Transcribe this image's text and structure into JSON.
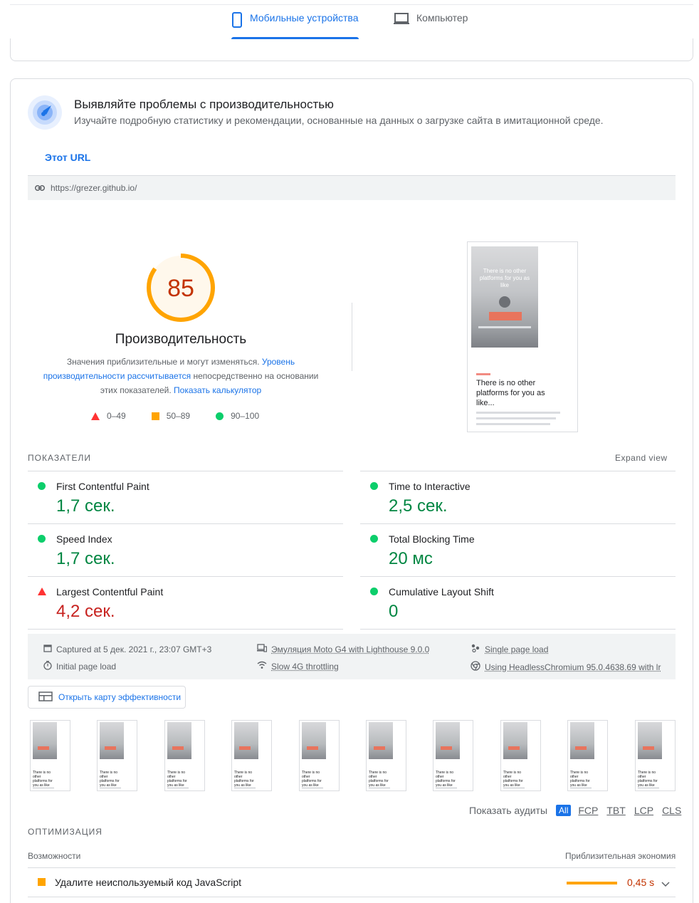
{
  "device_tabs": {
    "mobile": "Мобильные устройства",
    "desktop": "Компьютер"
  },
  "hero": {
    "title": "Выявляйте проблемы с производительностью",
    "subtitle": "Изучайте подробную статистику и рекомендации, основанные на данных о загрузке сайта в имитационной среде."
  },
  "url_tab": "Этот URL",
  "url": "https://grezer.github.io/",
  "score": {
    "value": "85",
    "fraction": 0.85,
    "title": "Производительность",
    "desc_1": "Значения приблизительные и могут изменяться. ",
    "desc_link_1": "Уровень производительности рассчитывается",
    "desc_2": " непосредственно на основании этих показателей. ",
    "desc_link_2": "Показать калькулятор",
    "legend": [
      "0–49",
      "50–89",
      "90–100"
    ]
  },
  "screenshot": {
    "hero_text": "There is no other platforms for you as like",
    "heading": "There is no other platforms for you as like..."
  },
  "metrics": {
    "section_title": "ПОКАЗАТЕЛИ",
    "expand": "Expand view",
    "left": [
      {
        "title": "First Contentful Paint",
        "value": "1,7 сек.",
        "status": "pass"
      },
      {
        "title": "Speed Index",
        "value": "1,7 сек.",
        "status": "pass"
      },
      {
        "title": "Largest Contentful Paint",
        "value": "4,2 сек.",
        "status": "fail"
      }
    ],
    "right": [
      {
        "title": "Time to Interactive",
        "value": "2,5 сек.",
        "status": "pass"
      },
      {
        "title": "Total Blocking Time",
        "value": "20 мс",
        "status": "pass"
      },
      {
        "title": "Cumulative Layout Shift",
        "value": "0",
        "status": "pass"
      }
    ]
  },
  "meta": {
    "captured": "Captured at 5 дек. 2021 г., 23:07 GMT+3",
    "initial": "Initial page load",
    "emulation": "Эмуляция Moto G4 with Lighthouse 9.0.0",
    "throttling": "Slow 4G throttling",
    "single": "Single page load",
    "browser": "Using HeadlessChromium 95.0.4638.69 with lr"
  },
  "treemap_button": "Открыть карту эффективности",
  "filmstrip": {
    "frame_text": "There is no other platforms for you as like"
  },
  "audit_filter": {
    "label": "Показать аудиты",
    "chips": [
      "All",
      "FCP",
      "TBT",
      "LCP",
      "CLS"
    ]
  },
  "optimization": {
    "title": "ОПТИМИЗАЦИЯ",
    "opportunities": "Возможности",
    "savings": "Приблизительная экономия",
    "items": [
      {
        "title": "Удалите неиспользуемый код JavaScript",
        "value": "0,45 s"
      }
    ]
  },
  "colors": {
    "accent": "#1a73e8",
    "pass": "#018642",
    "average": "#ffa400",
    "fail": "#c7221f"
  }
}
